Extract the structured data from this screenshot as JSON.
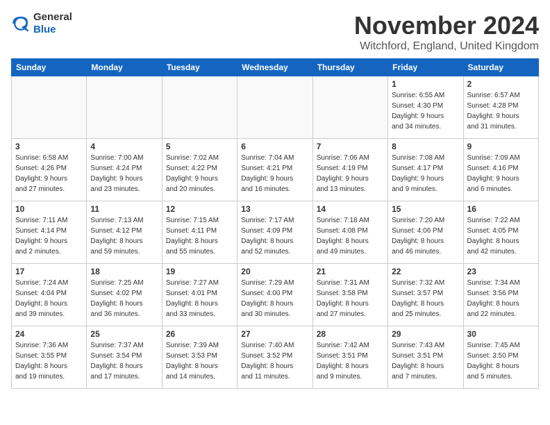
{
  "header": {
    "logo_line1": "General",
    "logo_line2": "Blue",
    "month": "November 2024",
    "location": "Witchford, England, United Kingdom"
  },
  "weekdays": [
    "Sunday",
    "Monday",
    "Tuesday",
    "Wednesday",
    "Thursday",
    "Friday",
    "Saturday"
  ],
  "weeks": [
    [
      {
        "day": "",
        "info": ""
      },
      {
        "day": "",
        "info": ""
      },
      {
        "day": "",
        "info": ""
      },
      {
        "day": "",
        "info": ""
      },
      {
        "day": "",
        "info": ""
      },
      {
        "day": "1",
        "info": "Sunrise: 6:55 AM\nSunset: 4:30 PM\nDaylight: 9 hours\nand 34 minutes."
      },
      {
        "day": "2",
        "info": "Sunrise: 6:57 AM\nSunset: 4:28 PM\nDaylight: 9 hours\nand 31 minutes."
      }
    ],
    [
      {
        "day": "3",
        "info": "Sunrise: 6:58 AM\nSunset: 4:26 PM\nDaylight: 9 hours\nand 27 minutes."
      },
      {
        "day": "4",
        "info": "Sunrise: 7:00 AM\nSunset: 4:24 PM\nDaylight: 9 hours\nand 23 minutes."
      },
      {
        "day": "5",
        "info": "Sunrise: 7:02 AM\nSunset: 4:22 PM\nDaylight: 9 hours\nand 20 minutes."
      },
      {
        "day": "6",
        "info": "Sunrise: 7:04 AM\nSunset: 4:21 PM\nDaylight: 9 hours\nand 16 minutes."
      },
      {
        "day": "7",
        "info": "Sunrise: 7:06 AM\nSunset: 4:19 PM\nDaylight: 9 hours\nand 13 minutes."
      },
      {
        "day": "8",
        "info": "Sunrise: 7:08 AM\nSunset: 4:17 PM\nDaylight: 9 hours\nand 9 minutes."
      },
      {
        "day": "9",
        "info": "Sunrise: 7:09 AM\nSunset: 4:16 PM\nDaylight: 9 hours\nand 6 minutes."
      }
    ],
    [
      {
        "day": "10",
        "info": "Sunrise: 7:11 AM\nSunset: 4:14 PM\nDaylight: 9 hours\nand 2 minutes."
      },
      {
        "day": "11",
        "info": "Sunrise: 7:13 AM\nSunset: 4:12 PM\nDaylight: 8 hours\nand 59 minutes."
      },
      {
        "day": "12",
        "info": "Sunrise: 7:15 AM\nSunset: 4:11 PM\nDaylight: 8 hours\nand 55 minutes."
      },
      {
        "day": "13",
        "info": "Sunrise: 7:17 AM\nSunset: 4:09 PM\nDaylight: 8 hours\nand 52 minutes."
      },
      {
        "day": "14",
        "info": "Sunrise: 7:18 AM\nSunset: 4:08 PM\nDaylight: 8 hours\nand 49 minutes."
      },
      {
        "day": "15",
        "info": "Sunrise: 7:20 AM\nSunset: 4:06 PM\nDaylight: 8 hours\nand 46 minutes."
      },
      {
        "day": "16",
        "info": "Sunrise: 7:22 AM\nSunset: 4:05 PM\nDaylight: 8 hours\nand 42 minutes."
      }
    ],
    [
      {
        "day": "17",
        "info": "Sunrise: 7:24 AM\nSunset: 4:04 PM\nDaylight: 8 hours\nand 39 minutes."
      },
      {
        "day": "18",
        "info": "Sunrise: 7:25 AM\nSunset: 4:02 PM\nDaylight: 8 hours\nand 36 minutes."
      },
      {
        "day": "19",
        "info": "Sunrise: 7:27 AM\nSunset: 4:01 PM\nDaylight: 8 hours\nand 33 minutes."
      },
      {
        "day": "20",
        "info": "Sunrise: 7:29 AM\nSunset: 4:00 PM\nDaylight: 8 hours\nand 30 minutes."
      },
      {
        "day": "21",
        "info": "Sunrise: 7:31 AM\nSunset: 3:58 PM\nDaylight: 8 hours\nand 27 minutes."
      },
      {
        "day": "22",
        "info": "Sunrise: 7:32 AM\nSunset: 3:57 PM\nDaylight: 8 hours\nand 25 minutes."
      },
      {
        "day": "23",
        "info": "Sunrise: 7:34 AM\nSunset: 3:56 PM\nDaylight: 8 hours\nand 22 minutes."
      }
    ],
    [
      {
        "day": "24",
        "info": "Sunrise: 7:36 AM\nSunset: 3:55 PM\nDaylight: 8 hours\nand 19 minutes."
      },
      {
        "day": "25",
        "info": "Sunrise: 7:37 AM\nSunset: 3:54 PM\nDaylight: 8 hours\nand 17 minutes."
      },
      {
        "day": "26",
        "info": "Sunrise: 7:39 AM\nSunset: 3:53 PM\nDaylight: 8 hours\nand 14 minutes."
      },
      {
        "day": "27",
        "info": "Sunrise: 7:40 AM\nSunset: 3:52 PM\nDaylight: 8 hours\nand 11 minutes."
      },
      {
        "day": "28",
        "info": "Sunrise: 7:42 AM\nSunset: 3:51 PM\nDaylight: 8 hours\nand 9 minutes."
      },
      {
        "day": "29",
        "info": "Sunrise: 7:43 AM\nSunset: 3:51 PM\nDaylight: 8 hours\nand 7 minutes."
      },
      {
        "day": "30",
        "info": "Sunrise: 7:45 AM\nSunset: 3:50 PM\nDaylight: 8 hours\nand 5 minutes."
      }
    ]
  ]
}
